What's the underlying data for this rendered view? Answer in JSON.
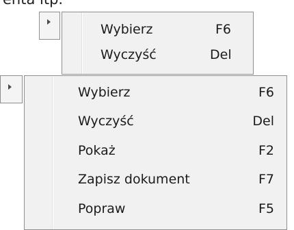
{
  "top_caption": "enta itp.",
  "small_menu": {
    "items": [
      {
        "label": "Wybierz",
        "shortcut": "F6"
      },
      {
        "label": "Wyczyść",
        "shortcut": "Del"
      }
    ]
  },
  "large_menu": {
    "items": [
      {
        "label": "Wybierz",
        "shortcut": "F6"
      },
      {
        "label": "Wyczyść",
        "shortcut": "Del"
      },
      {
        "label": "Pokaż",
        "shortcut": "F2"
      },
      {
        "label": "Zapisz dokument",
        "shortcut": "F7"
      },
      {
        "label": "Popraw",
        "shortcut": "F5"
      }
    ]
  },
  "icons": {
    "submenu_arrow": "triangle-right-icon"
  }
}
